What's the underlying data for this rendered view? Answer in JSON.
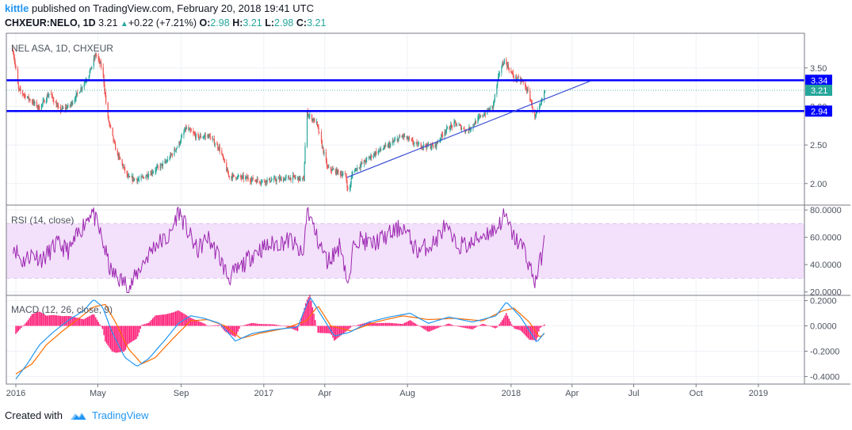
{
  "header": {
    "user": "kittle",
    "published_text": "published on TradingView.com, February 20, 2018 19:41 UTC",
    "symbol": "CHXEUR:NELO, 1D",
    "last": "3.21",
    "change": "+0.22 (+7.21%)",
    "o_label": "O:",
    "o_value": "2.98",
    "h_label": "H:",
    "h_value": "3.21",
    "l_label": "L:",
    "l_value": "2.98",
    "c_label": "C:",
    "c_value": "3.21"
  },
  "footer": {
    "created_with": "Created with",
    "brand": "TradingView"
  },
  "colors": {
    "up": "#26a69a",
    "down": "#ef5350",
    "level_line": "#0000ff",
    "trendline": "#3b4fd6",
    "rsi": "#9c27b0",
    "rsi_band": "#f3e0fb",
    "macd": "#2196f3",
    "signal": "#ff6d00",
    "hist": "#ff1a75"
  },
  "chart_data": [
    {
      "type": "candlestick",
      "title": "NEL ASA, 1D, CHXEUR",
      "x_ticks": [
        "2016",
        "May",
        "Sep",
        "2017",
        "Apr",
        "Aug",
        "2018",
        "Apr",
        "Jul",
        "Oct",
        "2019"
      ],
      "y_ticks": [
        "3.50",
        "3.00",
        "2.50",
        "2.00"
      ],
      "ylim": [
        1.72,
        3.95
      ],
      "xlim": [
        "2015-12-18",
        "2019-03-10"
      ],
      "horizontal_levels": [
        {
          "label": "3.34",
          "value": 3.34
        },
        {
          "label": "2.94",
          "value": 2.94
        }
      ],
      "last_price": {
        "label": "3.21",
        "value": 3.21
      },
      "trendline": {
        "start": [
          "2017-05-04",
          2.08
        ],
        "end": [
          "2018-04-28",
          3.33
        ]
      },
      "price_path": [
        [
          "2015-12-28",
          3.72
        ],
        [
          "2016-01-05",
          3.22
        ],
        [
          "2016-01-20",
          3.1
        ],
        [
          "2016-02-05",
          2.98
        ],
        [
          "2016-02-20",
          3.18
        ],
        [
          "2016-03-05",
          2.95
        ],
        [
          "2016-03-20",
          3.0
        ],
        [
          "2016-04-05",
          3.22
        ],
        [
          "2016-04-18",
          3.42
        ],
        [
          "2016-04-28",
          3.68
        ],
        [
          "2016-05-08",
          3.48
        ],
        [
          "2016-05-15",
          2.88
        ],
        [
          "2016-05-28",
          2.42
        ],
        [
          "2016-06-15",
          2.07
        ],
        [
          "2016-07-01",
          2.05
        ],
        [
          "2016-07-20",
          2.15
        ],
        [
          "2016-08-10",
          2.28
        ],
        [
          "2016-08-28",
          2.5
        ],
        [
          "2016-09-08",
          2.72
        ],
        [
          "2016-09-25",
          2.6
        ],
        [
          "2016-10-12",
          2.62
        ],
        [
          "2016-10-28",
          2.45
        ],
        [
          "2016-11-10",
          2.1
        ],
        [
          "2016-12-05",
          2.07
        ],
        [
          "2016-12-28",
          2.03
        ],
        [
          "2017-01-20",
          2.05
        ],
        [
          "2017-02-15",
          2.08
        ],
        [
          "2017-03-01",
          2.05
        ],
        [
          "2017-03-05",
          2.92
        ],
        [
          "2017-03-20",
          2.78
        ],
        [
          "2017-04-05",
          2.2
        ],
        [
          "2017-04-20",
          2.15
        ],
        [
          "2017-05-02",
          2.1
        ],
        [
          "2017-05-06",
          1.85
        ],
        [
          "2017-05-12",
          2.15
        ],
        [
          "2017-05-25",
          2.25
        ],
        [
          "2017-06-15",
          2.4
        ],
        [
          "2017-07-05",
          2.5
        ],
        [
          "2017-07-25",
          2.62
        ],
        [
          "2017-08-15",
          2.5
        ],
        [
          "2017-09-10",
          2.48
        ],
        [
          "2017-09-25",
          2.68
        ],
        [
          "2017-10-10",
          2.78
        ],
        [
          "2017-10-28",
          2.68
        ],
        [
          "2017-11-15",
          2.85
        ],
        [
          "2017-12-05",
          3.0
        ],
        [
          "2017-12-15",
          3.45
        ],
        [
          "2017-12-22",
          3.6
        ],
        [
          "2018-01-05",
          3.38
        ],
        [
          "2018-01-18",
          3.32
        ],
        [
          "2018-01-28",
          3.15
        ],
        [
          "2018-02-05",
          2.85
        ],
        [
          "2018-02-12",
          2.98
        ],
        [
          "2018-02-20",
          3.21
        ]
      ]
    },
    {
      "type": "line",
      "title": "RSI (14, close)",
      "y_ticks": [
        "80.0000",
        "60.0000",
        "40.0000",
        "20.0000"
      ],
      "ylim": [
        17.5,
        83
      ],
      "band": [
        30,
        70
      ],
      "path": [
        [
          "2015-12-28",
          55
        ],
        [
          "2016-01-10",
          42
        ],
        [
          "2016-01-25",
          48
        ],
        [
          "2016-02-10",
          44
        ],
        [
          "2016-03-01",
          55
        ],
        [
          "2016-03-20",
          50
        ],
        [
          "2016-04-05",
          65
        ],
        [
          "2016-04-22",
          80
        ],
        [
          "2016-05-05",
          62
        ],
        [
          "2016-05-12",
          50
        ],
        [
          "2016-05-20",
          35
        ],
        [
          "2016-06-05",
          28
        ],
        [
          "2016-06-18",
          24
        ],
        [
          "2016-07-05",
          40
        ],
        [
          "2016-07-25",
          55
        ],
        [
          "2016-08-15",
          60
        ],
        [
          "2016-08-28",
          80
        ],
        [
          "2016-09-10",
          65
        ],
        [
          "2016-09-25",
          50
        ],
        [
          "2016-10-10",
          60
        ],
        [
          "2016-10-28",
          45
        ],
        [
          "2016-11-10",
          30
        ],
        [
          "2016-11-28",
          38
        ],
        [
          "2016-12-20",
          50
        ],
        [
          "2017-01-15",
          55
        ],
        [
          "2017-02-10",
          58
        ],
        [
          "2017-02-28",
          45
        ],
        [
          "2017-03-06",
          82
        ],
        [
          "2017-03-20",
          60
        ],
        [
          "2017-04-05",
          42
        ],
        [
          "2017-04-25",
          55
        ],
        [
          "2017-05-06",
          22
        ],
        [
          "2017-05-15",
          60
        ],
        [
          "2017-06-10",
          55
        ],
        [
          "2017-07-05",
          62
        ],
        [
          "2017-07-25",
          68
        ],
        [
          "2017-08-15",
          50
        ],
        [
          "2017-09-10",
          56
        ],
        [
          "2017-09-25",
          68
        ],
        [
          "2017-10-10",
          55
        ],
        [
          "2017-11-01",
          54
        ],
        [
          "2017-11-20",
          62
        ],
        [
          "2017-12-10",
          66
        ],
        [
          "2017-12-22",
          76
        ],
        [
          "2018-01-05",
          60
        ],
        [
          "2018-01-20",
          52
        ],
        [
          "2018-02-05",
          27
        ],
        [
          "2018-02-12",
          40
        ],
        [
          "2018-02-20",
          58
        ]
      ]
    },
    {
      "type": "line",
      "title": "MACD (12, 26, close, 9)",
      "y_ticks": [
        "0.2000",
        "0.0000",
        "-0.2000",
        "-0.4000"
      ],
      "ylim": [
        -0.46,
        0.235
      ],
      "series": [
        {
          "name": "macd",
          "path": [
            [
              "2016-01-01",
              -0.42
            ],
            [
              "2016-01-18",
              -0.3
            ],
            [
              "2016-02-05",
              -0.15
            ],
            [
              "2016-02-25",
              -0.05
            ],
            [
              "2016-03-20",
              0.05
            ],
            [
              "2016-04-10",
              0.12
            ],
            [
              "2016-04-25",
              0.21
            ],
            [
              "2016-05-08",
              0.15
            ],
            [
              "2016-05-22",
              -0.05
            ],
            [
              "2016-06-10",
              -0.25
            ],
            [
              "2016-06-28",
              -0.32
            ],
            [
              "2016-07-15",
              -0.26
            ],
            [
              "2016-08-10",
              -0.1
            ],
            [
              "2016-08-28",
              0.02
            ],
            [
              "2016-09-15",
              0.08
            ],
            [
              "2016-10-05",
              0.06
            ],
            [
              "2016-10-28",
              0.02
            ],
            [
              "2016-11-20",
              -0.12
            ],
            [
              "2016-12-15",
              -0.06
            ],
            [
              "2017-01-15",
              -0.03
            ],
            [
              "2017-02-20",
              -0.01
            ],
            [
              "2017-03-10",
              0.23
            ],
            [
              "2017-03-25",
              0.1
            ],
            [
              "2017-04-15",
              -0.08
            ],
            [
              "2017-05-08",
              -0.05
            ],
            [
              "2017-06-05",
              0.03
            ],
            [
              "2017-07-05",
              0.07
            ],
            [
              "2017-08-05",
              0.1
            ],
            [
              "2017-09-01",
              0.02
            ],
            [
              "2017-10-01",
              0.07
            ],
            [
              "2017-11-05",
              0.03
            ],
            [
              "2017-12-10",
              0.08
            ],
            [
              "2017-12-25",
              0.19
            ],
            [
              "2018-01-15",
              0.07
            ],
            [
              "2018-02-08",
              -0.13
            ],
            [
              "2018-02-20",
              -0.05
            ]
          ]
        },
        {
          "name": "signal",
          "path": [
            [
              "2016-01-01",
              -0.38
            ],
            [
              "2016-01-25",
              -0.3
            ],
            [
              "2016-02-15",
              -0.15
            ],
            [
              "2016-03-10",
              -0.04
            ],
            [
              "2016-04-01",
              0.05
            ],
            [
              "2016-04-25",
              0.15
            ],
            [
              "2016-05-12",
              0.17
            ],
            [
              "2016-05-28",
              0.02
            ],
            [
              "2016-06-15",
              -0.18
            ],
            [
              "2016-07-05",
              -0.3
            ],
            [
              "2016-07-25",
              -0.25
            ],
            [
              "2016-08-20",
              -0.1
            ],
            [
              "2016-09-15",
              0.04
            ],
            [
              "2016-10-10",
              0.05
            ],
            [
              "2016-11-05",
              0.0
            ],
            [
              "2016-11-28",
              -0.1
            ],
            [
              "2016-12-25",
              -0.06
            ],
            [
              "2017-02-01",
              -0.02
            ],
            [
              "2017-03-05",
              0.04
            ],
            [
              "2017-03-22",
              0.16
            ],
            [
              "2017-04-10",
              0.0
            ],
            [
              "2017-05-10",
              -0.04
            ],
            [
              "2017-06-15",
              0.03
            ],
            [
              "2017-07-25",
              0.08
            ],
            [
              "2017-09-01",
              0.05
            ],
            [
              "2017-10-10",
              0.06
            ],
            [
              "2017-11-20",
              0.04
            ],
            [
              "2017-12-20",
              0.12
            ],
            [
              "2018-01-05",
              0.14
            ],
            [
              "2018-01-28",
              0.03
            ],
            [
              "2018-02-12",
              -0.09
            ],
            [
              "2018-02-20",
              -0.06
            ]
          ]
        }
      ]
    }
  ]
}
